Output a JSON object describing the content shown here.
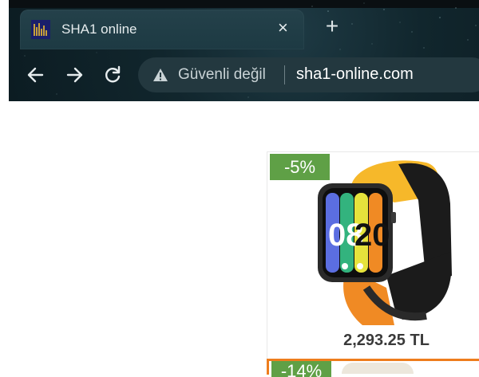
{
  "browser": {
    "tab": {
      "title": "SHA1 online",
      "close_glyph": "×"
    },
    "new_tab_glyph": "+",
    "address_bar": {
      "security_label": "Güvenli değil",
      "url": "sha1-online.com"
    },
    "icons": [
      "favicon-icon",
      "back-arrow-icon",
      "forward-arrow-icon",
      "reload-icon",
      "warning-icon",
      "close-icon",
      "plus-icon"
    ]
  },
  "products": [
    {
      "discount": "-5%",
      "price": "2,293.25 TL",
      "image": "smartwatch-image",
      "watch_display": "08 20"
    },
    {
      "discount": "-14%"
    }
  ],
  "colors": {
    "discount_badge": "#5fa046",
    "card_highlight": "#ee7d1d",
    "price_text": "#3a3a3a"
  }
}
